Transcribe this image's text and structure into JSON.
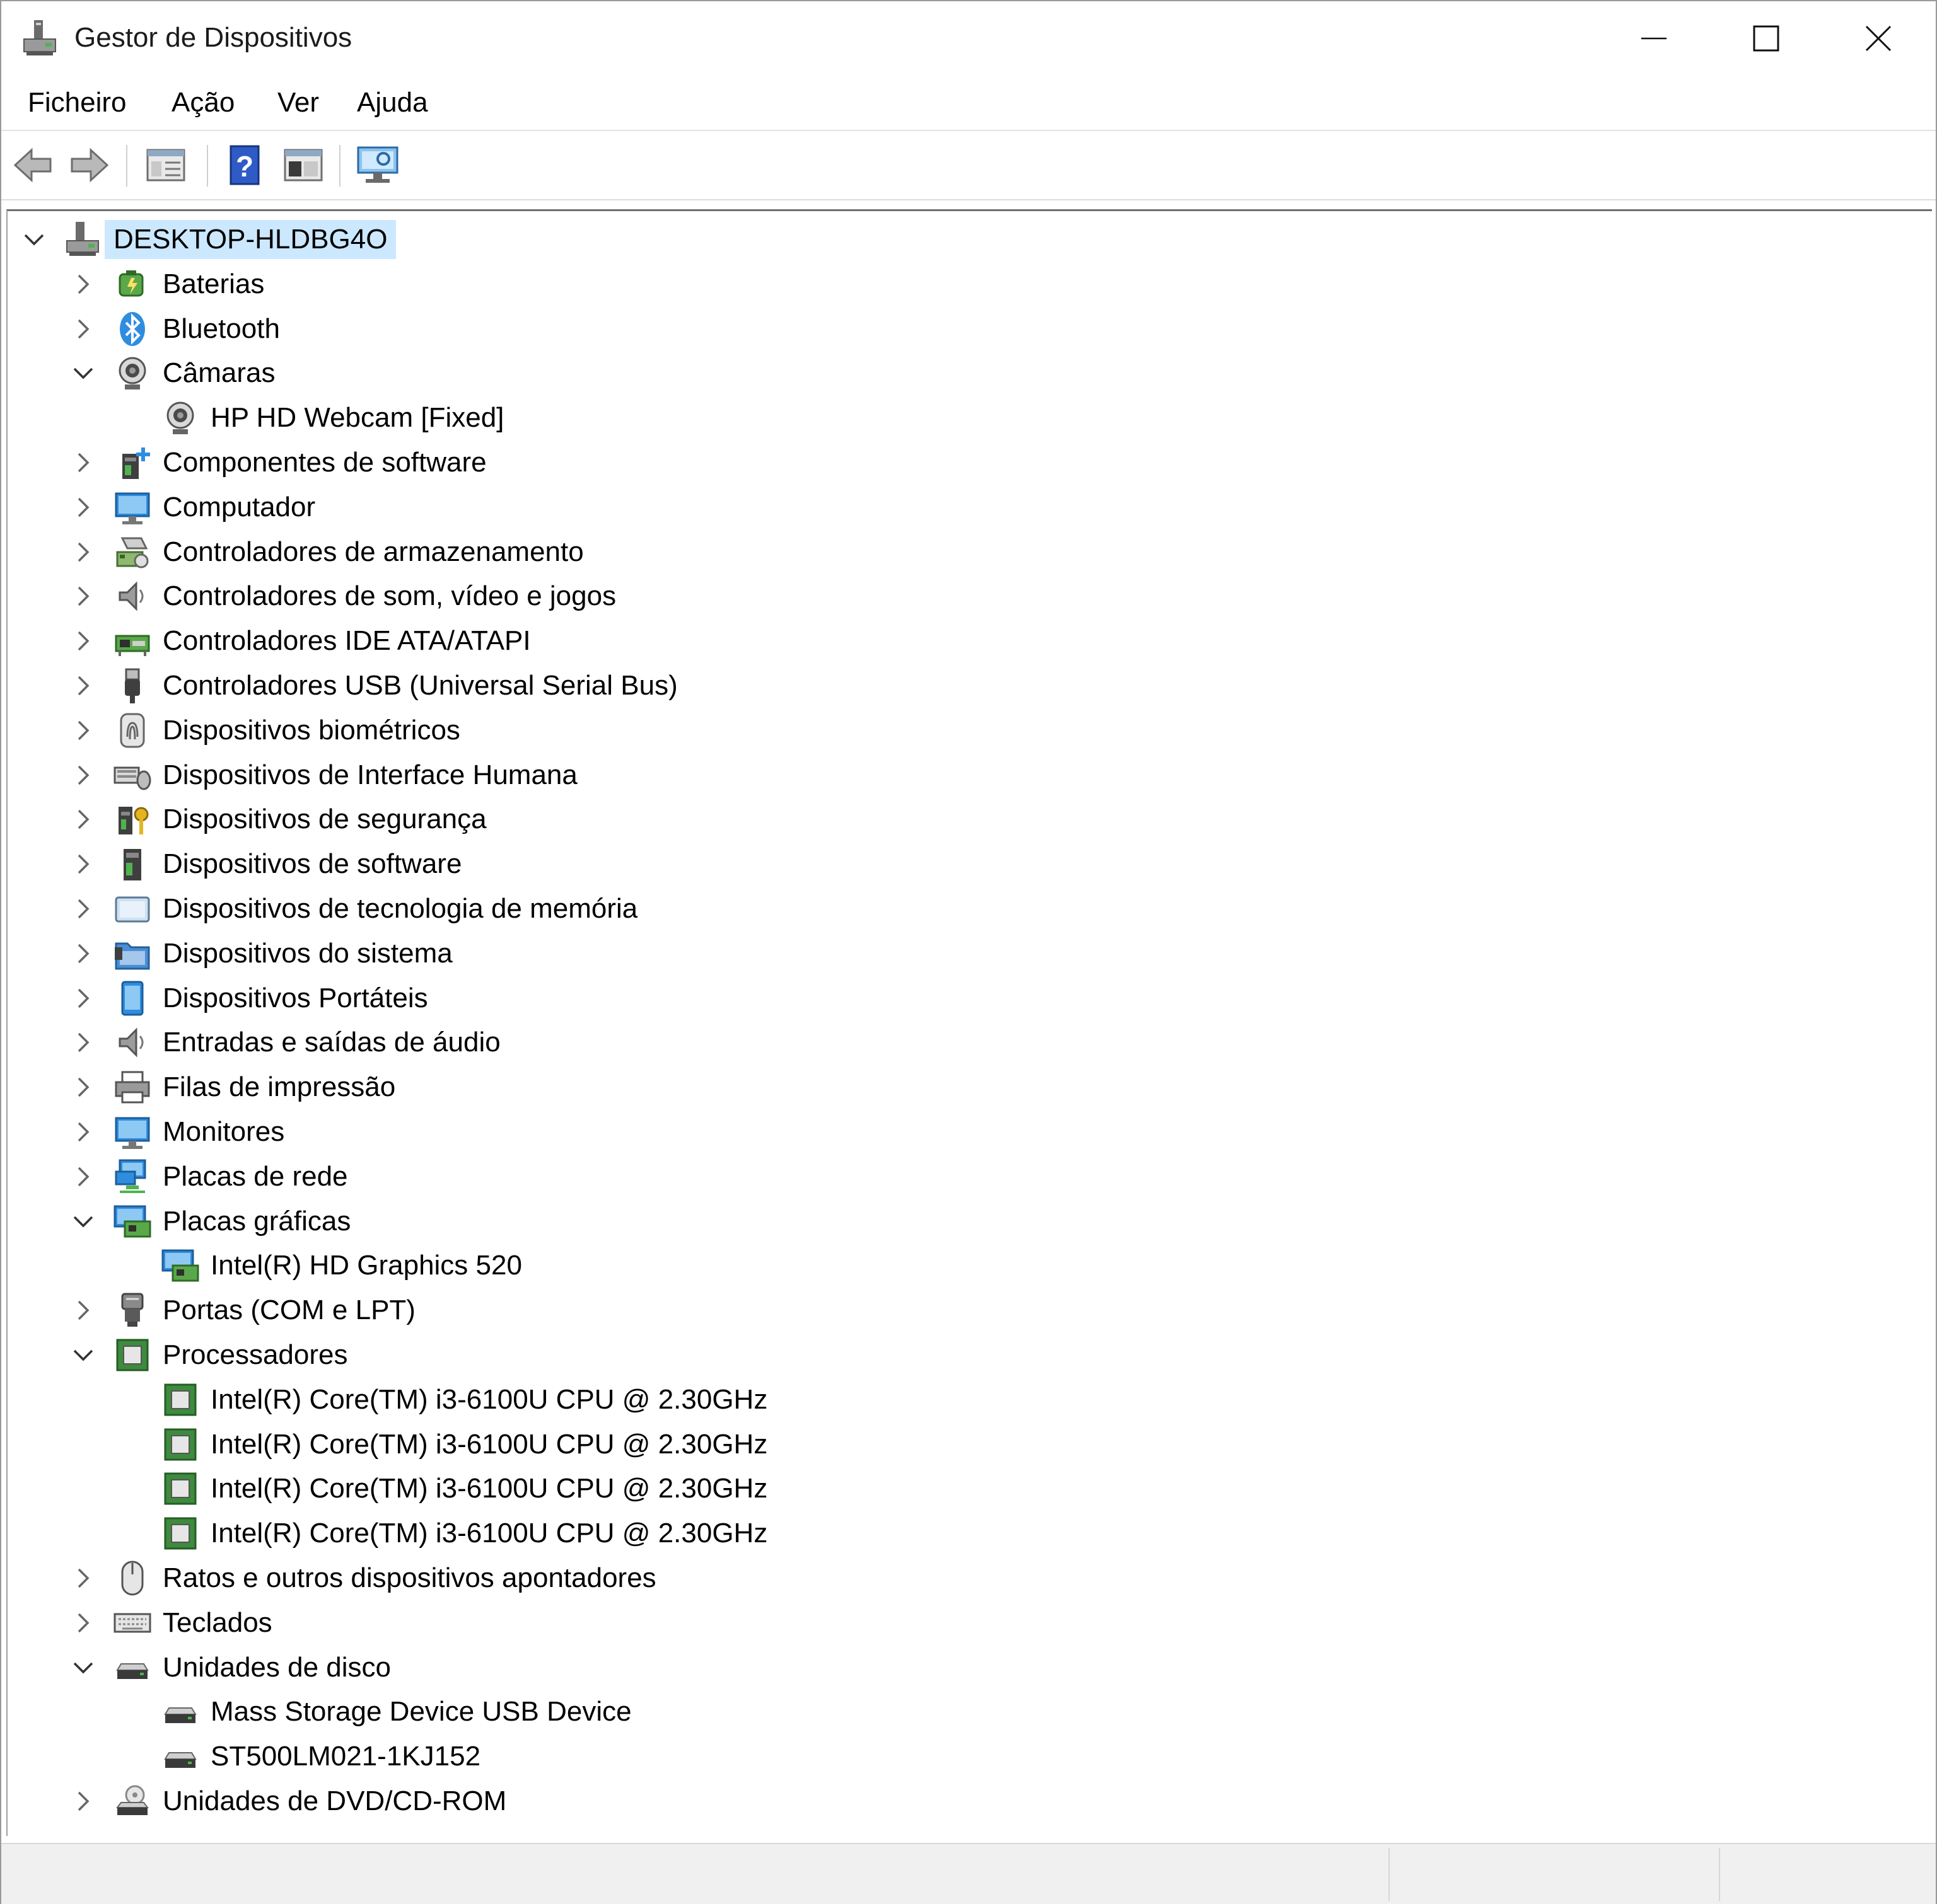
{
  "window": {
    "title": "Gestor de Dispositivos",
    "icon": "device-manager-icon"
  },
  "menubar": {
    "items": [
      "Ficheiro",
      "Ação",
      "Ver",
      "Ajuda"
    ]
  },
  "toolbar": {
    "buttons": [
      "back-arrow-icon",
      "forward-arrow-icon",
      "properties-icon",
      "help-icon",
      "update-driver-icon",
      "scan-hardware-icon"
    ]
  },
  "tree": {
    "root": "DESKTOP-HLDBG4O",
    "categories": [
      {
        "label": "Baterias",
        "icon": "battery-icon",
        "expanded": false
      },
      {
        "label": "Bluetooth",
        "icon": "bluetooth-icon",
        "expanded": false
      },
      {
        "label": "Câmaras",
        "icon": "camera-icon",
        "expanded": true
      },
      {
        "label": "HP HD Webcam [Fixed]",
        "icon": "camera-icon",
        "child": true
      },
      {
        "label": "Componentes de software",
        "icon": "software-component-icon",
        "expanded": false
      },
      {
        "label": "Computador",
        "icon": "computer-icon",
        "expanded": false
      },
      {
        "label": "Controladores de armazenamento",
        "icon": "storage-controller-icon",
        "expanded": false
      },
      {
        "label": "Controladores de som, vídeo e jogos",
        "icon": "speaker-icon",
        "expanded": false
      },
      {
        "label": "Controladores IDE ATA/ATAPI",
        "icon": "ide-controller-icon",
        "expanded": false
      },
      {
        "label": "Controladores USB (Universal Serial Bus)",
        "icon": "usb-icon",
        "expanded": false
      },
      {
        "label": "Dispositivos biométricos",
        "icon": "fingerprint-icon",
        "expanded": false
      },
      {
        "label": "Dispositivos de Interface Humana",
        "icon": "hid-icon",
        "expanded": false
      },
      {
        "label": "Dispositivos de segurança",
        "icon": "security-key-icon",
        "expanded": false
      },
      {
        "label": "Dispositivos de software",
        "icon": "software-device-icon",
        "expanded": false
      },
      {
        "label": "Dispositivos de tecnologia de memória",
        "icon": "memory-card-icon",
        "expanded": false
      },
      {
        "label": "Dispositivos do sistema",
        "icon": "system-folder-icon",
        "expanded": false
      },
      {
        "label": "Dispositivos Portáteis",
        "icon": "portable-device-icon",
        "expanded": false
      },
      {
        "label": "Entradas e saídas de áudio",
        "icon": "speaker-icon",
        "expanded": false
      },
      {
        "label": "Filas de impressão",
        "icon": "printer-icon",
        "expanded": false
      },
      {
        "label": "Monitores",
        "icon": "monitor-icon",
        "expanded": false
      },
      {
        "label": "Placas de rede",
        "icon": "network-icon",
        "expanded": false
      },
      {
        "label": "Placas gráficas",
        "icon": "display-adapter-icon",
        "expanded": true
      },
      {
        "label": "Intel(R) HD Graphics 520",
        "icon": "display-adapter-icon",
        "child": true
      },
      {
        "label": "Portas (COM e LPT)",
        "icon": "port-icon",
        "expanded": false
      },
      {
        "label": "Processadores",
        "icon": "processor-icon",
        "expanded": true
      },
      {
        "label": "Intel(R) Core(TM) i3-6100U CPU @ 2.30GHz",
        "icon": "processor-icon",
        "child": true
      },
      {
        "label": "Intel(R) Core(TM) i3-6100U CPU @ 2.30GHz",
        "icon": "processor-icon",
        "child": true
      },
      {
        "label": "Intel(R) Core(TM) i3-6100U CPU @ 2.30GHz",
        "icon": "processor-icon",
        "child": true
      },
      {
        "label": "Intel(R) Core(TM) i3-6100U CPU @ 2.30GHz",
        "icon": "processor-icon",
        "child": true
      },
      {
        "label": "Ratos e outros dispositivos apontadores",
        "icon": "mouse-icon",
        "expanded": false
      },
      {
        "label": "Teclados",
        "icon": "keyboard-icon",
        "expanded": false
      },
      {
        "label": "Unidades de disco",
        "icon": "disk-drive-icon",
        "expanded": true
      },
      {
        "label": "Mass Storage Device USB Device",
        "icon": "disk-drive-icon",
        "child": true
      },
      {
        "label": "ST500LM021-1KJ152",
        "icon": "disk-drive-icon",
        "child": true
      },
      {
        "label": "Unidades de DVD/CD-ROM",
        "icon": "dvd-drive-icon",
        "expanded": false
      }
    ]
  },
  "colors": {
    "selection": "#cce8ff",
    "accent": "#0078d7"
  }
}
